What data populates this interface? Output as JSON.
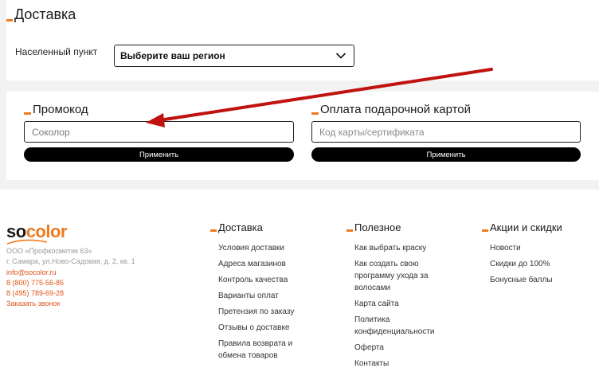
{
  "delivery": {
    "title": "Доставка",
    "city_label": "Населенный пункт",
    "region_select_value": "Выберите ваш регион"
  },
  "promo": {
    "title": "Промокод",
    "input_value": "Соколор",
    "apply_label": "Применить"
  },
  "gift_card": {
    "title": "Оплата подарочной картой",
    "input_placeholder": "Код карты/сертификата",
    "apply_label": "Применить"
  },
  "annotation": {
    "arrow_color": "#c0120f"
  },
  "footer": {
    "logo_so": "so",
    "logo_color": "color",
    "company_name": "ООО «Профкосметик 63»",
    "address": "г. Самара, ул.Ново-Садовая, д. 2, кв. 1",
    "email": "info@socolor.ru",
    "phone1": "8 (800) 775-56-85",
    "phone2": "8 (495) 789-69-28",
    "callback": "Заказать звонок",
    "columns": [
      {
        "title": "Доставка",
        "links": [
          "Условия доставки",
          "Адреса магазинов",
          "Контроль качества",
          "Варианты оплат",
          "Претензия по заказу",
          "Отзывы о доставке",
          "Правила возврата и обмена товаров"
        ]
      },
      {
        "title": "Полезное",
        "links": [
          "Как выбрать краску",
          "Как создать свою программу ухода за волосами",
          "Карта сайта",
          "Политика конфиденциальности",
          "Оферта",
          "Контакты"
        ]
      },
      {
        "title": "Акции и скидки",
        "links": [
          "Новости",
          "Скидки до 100%",
          "Бонусные баллы"
        ]
      }
    ]
  },
  "colors": {
    "accent": "#f07a1e",
    "link_orange": "#e0531a",
    "button_black": "#000000"
  }
}
